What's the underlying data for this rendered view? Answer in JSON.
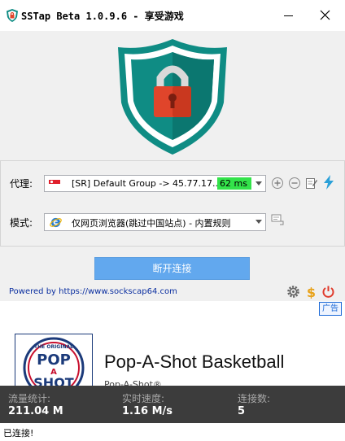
{
  "window": {
    "title": "SSTap Beta 1.0.9.6 - 享受游戏"
  },
  "panel": {
    "proxy_label": "代理:",
    "proxy_value": "[SR] Default Group -> 45.77.17...",
    "latency": "62 ms",
    "mode_label": "模式:",
    "mode_value": "仅网页浏览器(跳过中国站点) - 内置规则"
  },
  "connect_button": "断开连接",
  "powered_by": "Powered by https://www.sockscap64.com",
  "ad": {
    "tag": "广告",
    "title": "Pop-A-Shot Basketball",
    "subtitle": "Pop-A-Shot®",
    "logo_text": {
      "top": "THE ORIGINAL",
      "line1": "POP",
      "line2": "A",
      "line3": "SHOT"
    }
  },
  "stats": [
    {
      "label": "流量统计:",
      "value": "211.04 M"
    },
    {
      "label": "实时速度:",
      "value": "1.16 M/s"
    },
    {
      "label": "连接数:",
      "value": "5"
    }
  ],
  "status": "已连接!",
  "colors": {
    "shield_teal": "#0f8c84",
    "lock_red": "#e0452b",
    "connect_blue": "#62a8ee",
    "latency_green": "#33e34a"
  }
}
